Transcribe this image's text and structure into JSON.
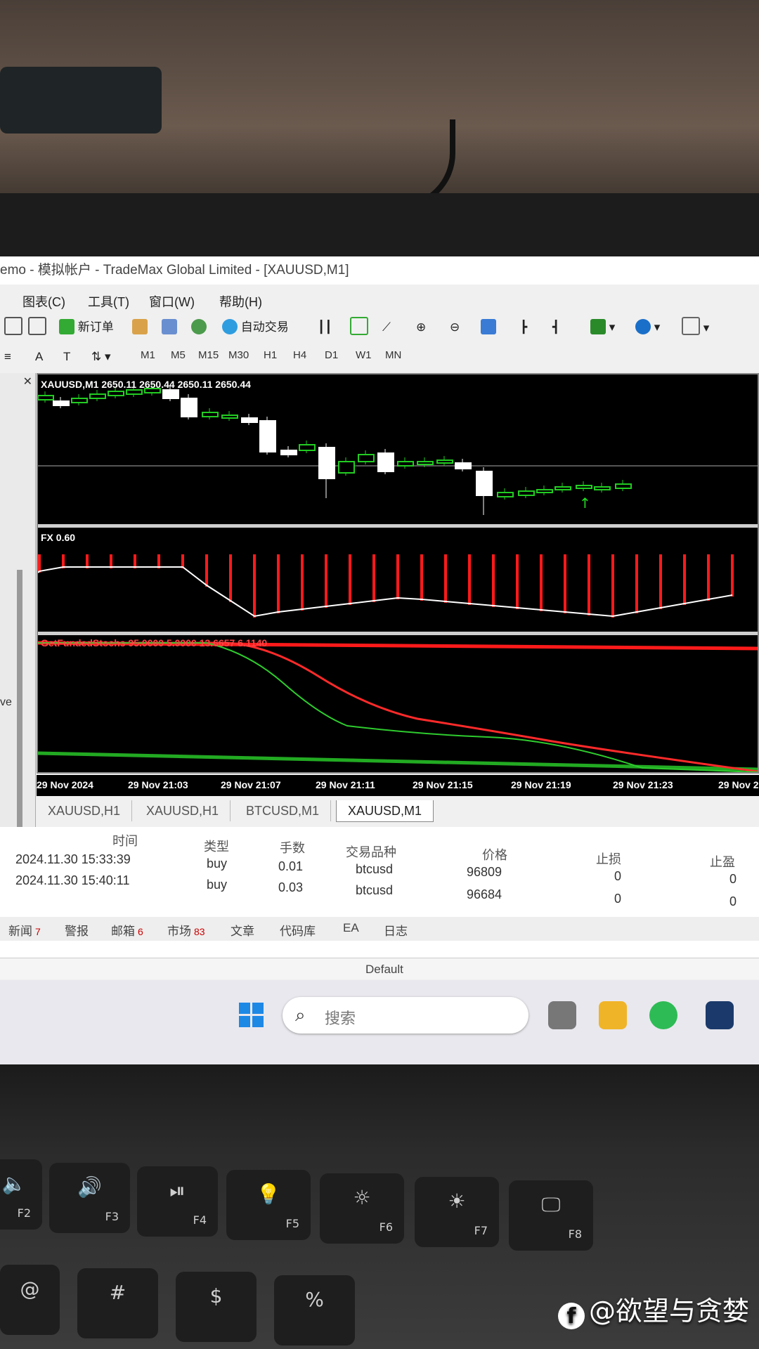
{
  "window": {
    "title": "emo - 模拟帐户 - TradeMax Global Limited - [XAUUSD,M1]"
  },
  "menu": [
    "图表(C)",
    "工具(T)",
    "窗口(W)",
    "帮助(H)"
  ],
  "toolbar": {
    "new_order": "新订单",
    "auto_trade": "自动交易"
  },
  "timeframes": [
    "M1",
    "M5",
    "M15",
    "M30",
    "H1",
    "H4",
    "D1",
    "W1",
    "MN"
  ],
  "chart": {
    "symbol_label": "XAUUSD,M1  2650.11 2650.44 2650.11 2650.44",
    "indicator1_label": "FX 0.60",
    "indicator2_label": "GetFundedStochs 95.0000 5.0000 13.6657 6.1140",
    "time_ticks": [
      "29 Nov 2024",
      "29 Nov 21:03",
      "29 Nov 21:07",
      "29 Nov 21:11",
      "29 Nov 21:15",
      "29 Nov 21:19",
      "29 Nov 21:23",
      "29 Nov 2"
    ],
    "colors": {
      "bull": "#22cc22",
      "bear": "#ffffff",
      "histogram": "#ff1a1a",
      "stoch_main": "#ff2a2a",
      "stoch_signal": "#2ecc2e"
    }
  },
  "chart_tabs": [
    "XAUUSD,H1",
    "XAUUSD,H1",
    "BTCUSD,M1",
    "XAUUSD,M1"
  ],
  "orders": {
    "headers": [
      "时间",
      "类型",
      "手数",
      "交易品种",
      "价格",
      "止损",
      "止盈"
    ],
    "rows": [
      [
        "2024.11.30 15:33:39",
        "buy",
        "0.01",
        "btcusd",
        "96809",
        "0",
        "0"
      ],
      [
        "2024.11.30 15:40:11",
        "buy",
        "0.03",
        "btcusd",
        "96684",
        "0",
        "0"
      ]
    ]
  },
  "terminal_tabs": [
    {
      "label": "新闻",
      "count": "7"
    },
    {
      "label": "警报",
      "count": ""
    },
    {
      "label": "邮箱",
      "count": "6"
    },
    {
      "label": "市场",
      "count": "83"
    },
    {
      "label": "文章",
      "count": ""
    },
    {
      "label": "代码库",
      "count": ""
    },
    {
      "label": "EA",
      "count": ""
    },
    {
      "label": "日志",
      "count": ""
    }
  ],
  "status": {
    "profile": "Default"
  },
  "taskbar": {
    "search_placeholder": "搜索"
  },
  "keyboard": [
    {
      "glyph": "🔈",
      "fkey": "F2"
    },
    {
      "glyph": "🔊",
      "fkey": "F3"
    },
    {
      "glyph": "⏯",
      "fkey": "F4"
    },
    {
      "glyph": "💡",
      "fkey": "F5"
    },
    {
      "glyph": "☼",
      "fkey": "F6"
    },
    {
      "glyph": "☀",
      "fkey": "F7"
    },
    {
      "glyph": "🖵",
      "fkey": "F8"
    }
  ],
  "keyboard_row2": [
    "@",
    "#",
    "$",
    "%"
  ],
  "watermark": "@欲望与贪婪"
}
